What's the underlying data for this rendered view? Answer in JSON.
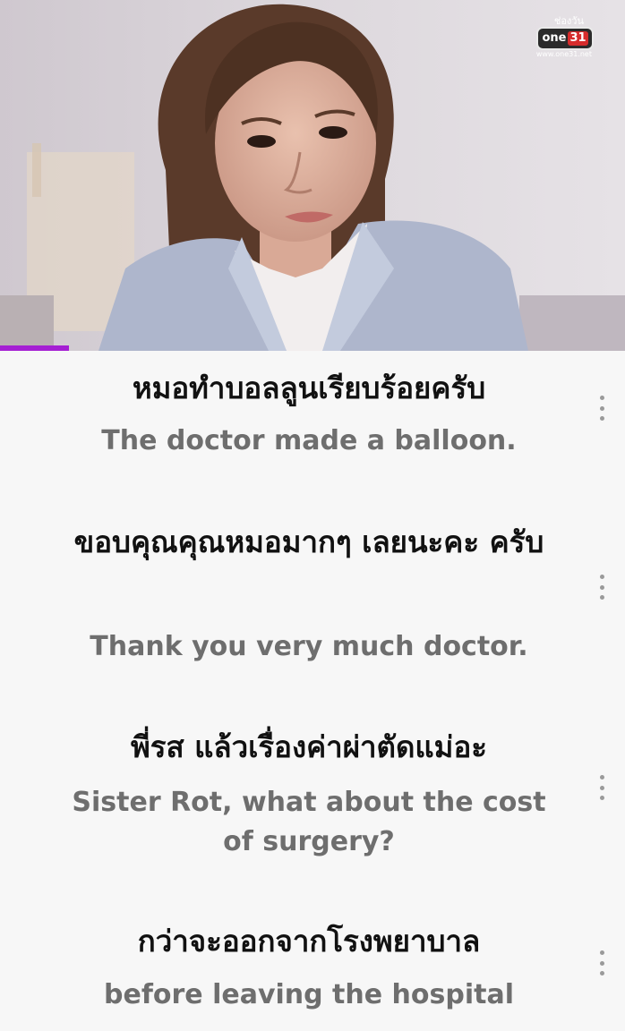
{
  "video": {
    "channel_small_text": "ช่องวัน",
    "channel_logo_text": "one",
    "channel_logo_number": "31",
    "channel_url": "www.one31.net",
    "progress_fraction": 0.11,
    "accent_color": "#a51fd3"
  },
  "subtitles": [
    {
      "thai": "หมอทำบอลลูนเรียบร้อยครับ",
      "english": "The doctor made a balloon."
    },
    {
      "thai": "ขอบคุณคุณหมอมากๆ เลยนะคะ ครับ",
      "english": "Thank you very much doctor."
    },
    {
      "thai": "พี่รส แล้วเรื่องค่าผ่าตัดแม่อะ",
      "english": "Sister Rot, what about the cost of surgery?"
    },
    {
      "thai": "กว่าจะออกจากโรงพยาบาล",
      "english": "before leaving the hospital"
    }
  ],
  "icons": {
    "more_menu": "more-vert-icon"
  }
}
